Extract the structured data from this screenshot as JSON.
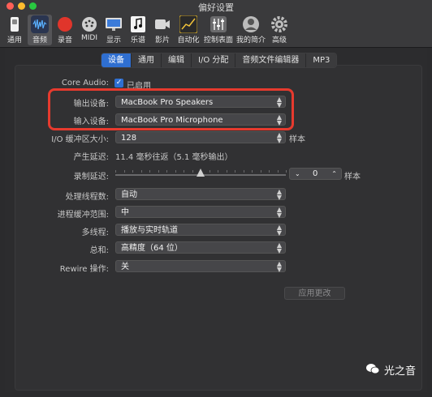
{
  "window": {
    "title": "偏好设置"
  },
  "toolbar": {
    "items": [
      {
        "label": "通用",
        "icon": "general-switch-icon"
      },
      {
        "label": "音频",
        "icon": "audio-waveform-icon",
        "active": true
      },
      {
        "label": "录音",
        "icon": "record-icon"
      },
      {
        "label": "MIDI",
        "icon": "midi-connector-icon"
      },
      {
        "label": "显示",
        "icon": "display-monitor-icon"
      },
      {
        "label": "乐谱",
        "icon": "music-score-icon"
      },
      {
        "label": "影片",
        "icon": "film-icon"
      },
      {
        "label": "自动化",
        "icon": "automation-icon"
      },
      {
        "label": "控制表面",
        "icon": "control-surface-icon"
      },
      {
        "label": "我的简介",
        "icon": "profile-icon"
      },
      {
        "label": "高级",
        "icon": "gear-icon"
      }
    ]
  },
  "tabs": [
    "设备",
    "通用",
    "编辑",
    "I/O 分配",
    "音频文件编辑器",
    "MP3"
  ],
  "active_tab": "设备",
  "form": {
    "core_audio": {
      "label": "Core Audio:",
      "value": "已启用",
      "checked": true
    },
    "output_device": {
      "label": "输出设备:",
      "value": "MacBook Pro Speakers"
    },
    "input_device": {
      "label": "输入设备:",
      "value": "MacBook Pro Microphone"
    },
    "io_buffer": {
      "label": "I/O 缓冲区大小:",
      "value": "128",
      "unit": "样本"
    },
    "latency": {
      "label": "产生延迟:",
      "value": "11.4 毫秒往返（5.1 毫秒输出）"
    },
    "record_delay": {
      "label": "录制延迟:",
      "value": "0",
      "unit": "样本",
      "slider_fraction": 0.5
    },
    "threads": {
      "label": "处理线程数:",
      "value": "自动"
    },
    "process_buffer": {
      "label": "进程缓冲范围:",
      "value": "中"
    },
    "multithreading": {
      "label": "多线程:",
      "value": "播放与实时轨道"
    },
    "summing": {
      "label": "总和:",
      "value": "高精度（64 位）"
    },
    "rewire": {
      "label": "Rewire 操作:",
      "value": "关"
    }
  },
  "apply_button": "应用更改",
  "watermark": "光之音",
  "colors": {
    "accent": "#2f6fd1",
    "highlight": "#e63a2e",
    "record": "#e0352b"
  }
}
